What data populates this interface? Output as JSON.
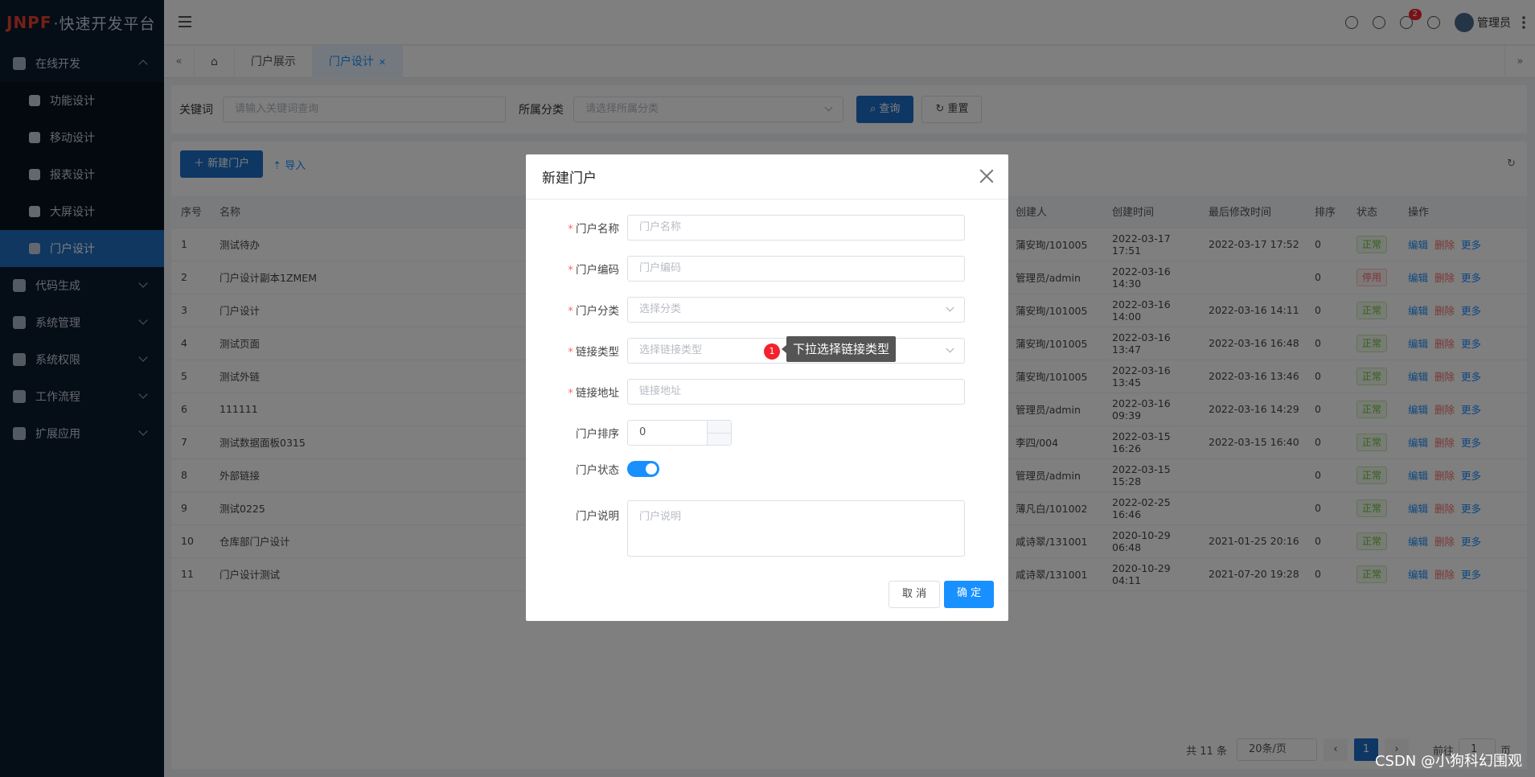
{
  "app": {
    "logo_a": "JNPF",
    "logo_b": "·快速开发平台"
  },
  "sidebar": {
    "groups": [
      {
        "label": "在线开发"
      },
      {
        "label": "代码生成"
      },
      {
        "label": "系统管理"
      },
      {
        "label": "系统权限"
      },
      {
        "label": "工作流程"
      },
      {
        "label": "扩展应用"
      }
    ],
    "sub": [
      {
        "label": "功能设计"
      },
      {
        "label": "移动设计"
      },
      {
        "label": "报表设计"
      },
      {
        "label": "大屏设计"
      },
      {
        "label": "门户设计"
      }
    ]
  },
  "header": {
    "notif_count": "2",
    "user": "管理员"
  },
  "tabs": [
    {
      "label": "门户展示"
    },
    {
      "label": "门户设计"
    }
  ],
  "search": {
    "kw_label": "关键词",
    "kw_ph": "请输入关键词查询",
    "cat_label": "所属分类",
    "cat_ph": "请选择所属分类",
    "query": "查询",
    "reset": "重置"
  },
  "toolbar": {
    "new": "新建门户",
    "import": "导入"
  },
  "table": {
    "headers": [
      "序号",
      "名称",
      "创建人",
      "创建时间",
      "最后修改时间",
      "排序",
      "状态",
      "操作"
    ],
    "rows": [
      [
        "1",
        "测试待办",
        "蒲安珣/101005",
        "2022-03-17 17:51",
        "2022-03-17 17:52",
        "0",
        "正常"
      ],
      [
        "2",
        "门户设计副本1ZMEM",
        "管理员/admin",
        "2022-03-16 14:30",
        "",
        "0",
        "停用"
      ],
      [
        "3",
        "门户设计",
        "蒲安珣/101005",
        "2022-03-16 14:00",
        "2022-03-16 14:11",
        "0",
        "正常"
      ],
      [
        "4",
        "测试页面",
        "蒲安珣/101005",
        "2022-03-16 13:47",
        "2022-03-16 16:48",
        "0",
        "正常"
      ],
      [
        "5",
        "测试外链",
        "蒲安珣/101005",
        "2022-03-16 13:45",
        "2022-03-16 13:46",
        "0",
        "正常"
      ],
      [
        "6",
        "111111",
        "管理员/admin",
        "2022-03-16 09:39",
        "2022-03-16 14:29",
        "0",
        "正常"
      ],
      [
        "7",
        "测试数据面板0315",
        "李四/004",
        "2022-03-15 16:26",
        "2022-03-15 16:40",
        "0",
        "正常"
      ],
      [
        "8",
        "外部链接",
        "管理员/admin",
        "2022-03-15 15:28",
        "",
        "0",
        "正常"
      ],
      [
        "9",
        "测试0225",
        "薄凡白/101002",
        "2022-02-25 16:46",
        "",
        "0",
        "正常"
      ],
      [
        "10",
        "仓库部门户设计",
        "咸诗翠/131001",
        "2020-10-29 06:48",
        "2021-01-25 20:16",
        "0",
        "正常"
      ],
      [
        "11",
        "门户设计测试",
        "咸诗翠/131001",
        "2020-10-29 04:11",
        "2021-07-20 19:28",
        "0",
        "正常"
      ]
    ],
    "ops": {
      "edit": "编辑",
      "del": "删除",
      "more": "更多"
    }
  },
  "pager": {
    "total": "共 11 条",
    "size": "20条/页",
    "page": "1",
    "goto": "前往",
    "goto_val": "1",
    "unit": "页"
  },
  "dialog": {
    "title": "新建门户",
    "fields": {
      "name": {
        "label": "门户名称",
        "ph": "门户名称"
      },
      "code": {
        "label": "门户编码",
        "ph": "门户编码"
      },
      "cat": {
        "label": "门户分类",
        "ph": "选择分类"
      },
      "link_type": {
        "label": "链接类型",
        "ph": "选择链接类型"
      },
      "link": {
        "label": "链接地址",
        "ph": "链接地址"
      },
      "sort": {
        "label": "门户排序",
        "value": "0"
      },
      "status": {
        "label": "门户状态",
        "on": true
      },
      "desc": {
        "label": "门户说明",
        "ph": "门户说明"
      }
    },
    "tip_num": "1",
    "tip_text": "下拉选择链接类型",
    "cancel": "取 消",
    "ok": "确 定"
  },
  "watermark": "CSDN @小狗科幻围观"
}
